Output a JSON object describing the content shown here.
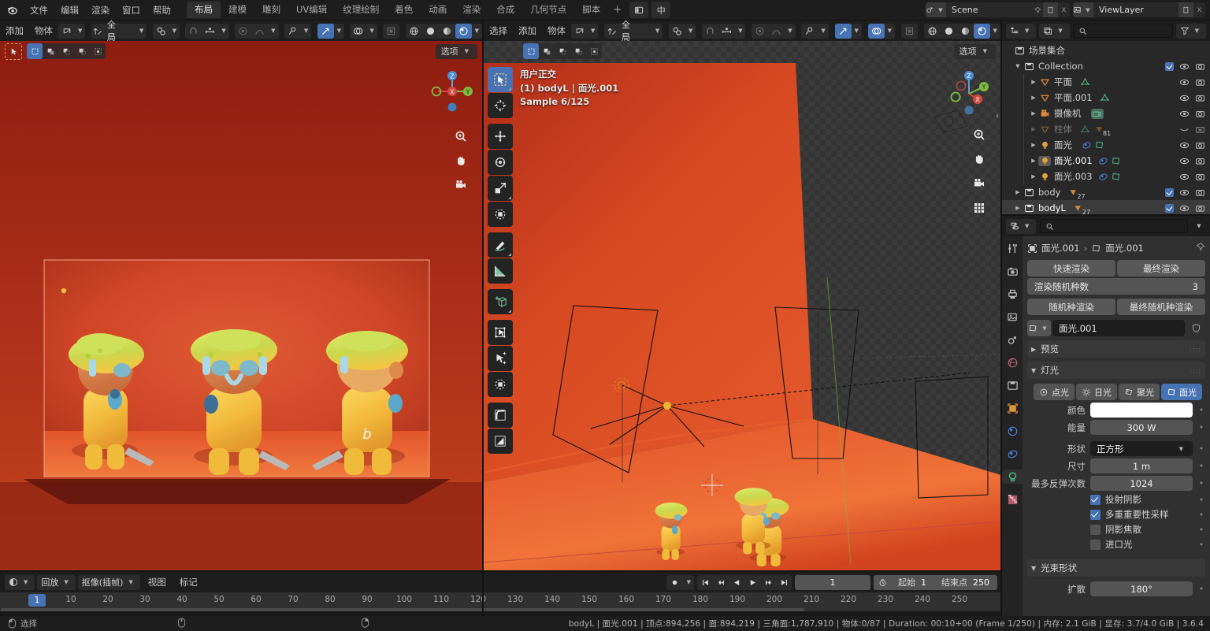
{
  "topbar": {
    "logo_icon": "blender-logo",
    "menus": [
      "文件",
      "编辑",
      "渲染",
      "窗口",
      "帮助"
    ],
    "workspaces": [
      "布局",
      "建模",
      "雕刻",
      "UV编辑",
      "纹理绘制",
      "着色",
      "动画",
      "渲染",
      "合成",
      "几何节点",
      "脚本"
    ],
    "workspace_active": "布局",
    "add_workspace": "+",
    "screen_icon": "screen-icon",
    "lang_label": "中",
    "scene": {
      "name": "Scene",
      "icon": "scene-icon",
      "pin_icon": "pin-icon",
      "new_icon": "duplicate-icon",
      "unlink": "x"
    },
    "viewlayer": {
      "name": "ViewLayer",
      "icon": "viewlayer-icon",
      "new_icon": "duplicate-icon",
      "unlink": "x"
    }
  },
  "header_left": {
    "menus": [
      "添加",
      "物体"
    ],
    "transform_orientation": "全局",
    "snap_icon": "magnet-icon",
    "proportional_icon": "proportional-icon",
    "shading_modes": [
      "wireframe-icon",
      "solid-icon",
      "material-preview-icon",
      "rendered-icon"
    ],
    "shading_active": "rendered-icon"
  },
  "header_right": {
    "menus": [
      "选择",
      "添加",
      "物体"
    ],
    "transform_orientation": "全局",
    "snap_icon": "magnet-icon",
    "proportional_icon": "proportional-icon",
    "shading_modes": [
      "wireframe-icon",
      "solid-icon",
      "material-preview-icon",
      "rendered-icon"
    ],
    "shading_active": "rendered-icon"
  },
  "viewport_left": {
    "options_label": "选项",
    "select_modes": [
      "tweak-icon",
      "box-select-icon",
      "circle-select-icon",
      "lasso-select-icon",
      "select-box-icon"
    ],
    "gizmo_axes": [
      "Z",
      "Y",
      "X"
    ]
  },
  "viewport_right": {
    "options_label": "选项",
    "overlay_view": "用户正交",
    "overlay_object": "(1) bodyL | 面光.001",
    "overlay_sample": "Sample 6/125",
    "gizmo_axes": [
      "Z",
      "Y",
      "X"
    ],
    "nav_buttons": [
      "zoom-icon",
      "pan-hand-icon",
      "camera-view-icon",
      "toggle-ortho-icon"
    ],
    "tools": [
      "tweak-select-icon",
      "cursor-icon",
      "move-icon",
      "rotate-icon",
      "scale-icon",
      "transform-icon",
      "annotate-icon",
      "measure-icon",
      "add-cube-icon",
      "shear-icon",
      "to-sphere-icon",
      "transform-fallback-icon",
      "bend-icon",
      "mirror-icon"
    ],
    "tool_active": "tweak-select-icon"
  },
  "outliner": {
    "display_mode_icon": "outliner-display-icon",
    "filter_icon": "filter-icon",
    "search_placeholder": "",
    "scene_collection": "场景集合",
    "items": [
      {
        "label": "Collection",
        "icon": "collection-icon",
        "indent": 1,
        "expanded": true,
        "checkbox": true,
        "eye": true,
        "camera": true,
        "disclosure": "down"
      },
      {
        "label": "平面",
        "icon": "mesh-icon",
        "indent": 2,
        "data_icons": [
          "mesh-data-icon"
        ],
        "eye": true,
        "camera": true,
        "disclosure": "right"
      },
      {
        "label": "平面.001",
        "icon": "mesh-icon",
        "indent": 2,
        "data_icons": [
          "mesh-data-icon"
        ],
        "eye": true,
        "camera": true,
        "disclosure": "right"
      },
      {
        "label": "摄像机",
        "icon": "camera-obj-icon",
        "indent": 2,
        "data_icons": [
          "camera-data-icon"
        ],
        "eye": true,
        "camera": true,
        "disclosure": "right"
      },
      {
        "label": "柱体",
        "icon": "mesh-icon",
        "indent": 2,
        "dim": true,
        "data_icons": [
          "mesh-data-icon",
          "material-icon"
        ],
        "badge": "81",
        "eye": false,
        "camera": false,
        "disclosure": "right"
      },
      {
        "label": "面光",
        "icon": "light-icon",
        "indent": 2,
        "data_icons": [
          "light-data-icon",
          "area-light-icon"
        ],
        "eye": true,
        "camera": true,
        "disclosure": "right"
      },
      {
        "label": "面光.001",
        "icon": "light-icon",
        "indent": 2,
        "selected": true,
        "data_icons": [
          "light-data-icon",
          "area-light-icon"
        ],
        "eye": true,
        "camera": true,
        "disclosure": "right"
      },
      {
        "label": "面光.003",
        "icon": "light-icon",
        "indent": 2,
        "data_icons": [
          "light-data-icon",
          "area-light-icon"
        ],
        "eye": true,
        "camera": true,
        "disclosure": "right"
      },
      {
        "label": "body",
        "icon": "collection-icon",
        "indent": 1,
        "data_icons": [
          "material-icon"
        ],
        "badge": "27",
        "checkbox": true,
        "eye": true,
        "camera": true,
        "disclosure": "right"
      },
      {
        "label": "bodyL",
        "icon": "collection-icon",
        "indent": 1,
        "selected": true,
        "data_icons": [
          "material-icon"
        ],
        "badge": "27",
        "checkbox": true,
        "eye": true,
        "camera": true,
        "disclosure": "right"
      }
    ]
  },
  "properties": {
    "editor_icon": "properties-editor-icon",
    "search_placeholder": "",
    "breadcrumb": {
      "object": "面光.001",
      "separator": "›",
      "data": "面光.001",
      "object_icon": "object-icon",
      "data_icon": "area-light-icon",
      "pin_icon": "pin-icon"
    },
    "tabs": [
      "tool-icon",
      "render-icon",
      "output-icon",
      "viewlayer-icon",
      "scene-icon",
      "world-icon",
      "collection-icon",
      "object-icon",
      "physics-icon",
      "constraints-icon",
      "data-light-icon",
      "texture-icon"
    ],
    "tab_active": "data-light-icon",
    "quick_render": "快速渲染",
    "final_render": "最终渲染",
    "seed_label": "渲染随机种数",
    "seed_value": "3",
    "seed_render": "随机种渲染",
    "seed_final_render": "最终随机种渲染",
    "datablock_name": "面光.001",
    "panels": {
      "preview": "预览",
      "light": "灯光",
      "beam_shape": "光束形状"
    },
    "light_types": [
      {
        "label": "点光",
        "icon": "point-light-icon",
        "active": false
      },
      {
        "label": "日光",
        "icon": "sun-light-icon",
        "active": false
      },
      {
        "label": "聚光",
        "icon": "spot-light-icon",
        "active": false
      },
      {
        "label": "面光",
        "icon": "area-light-icon",
        "active": true
      }
    ],
    "fields": [
      {
        "label": "颜色",
        "value": "",
        "type": "color",
        "color": "#ffffff"
      },
      {
        "label": "能量",
        "value": "300 W",
        "type": "number"
      },
      {
        "label": "形状",
        "value": "正方形",
        "type": "dropdown"
      },
      {
        "label": "尺寸",
        "value": "1 m",
        "type": "number"
      },
      {
        "label": "最多反弹次数",
        "value": "1024",
        "type": "number"
      }
    ],
    "checkboxes": [
      {
        "label": "投射阴影",
        "checked": true
      },
      {
        "label": "多重重要性采样",
        "checked": true
      },
      {
        "label": "阴影焦散",
        "checked": false
      },
      {
        "label": "进口光",
        "checked": false
      }
    ],
    "beam_fields": [
      {
        "label": "扩散",
        "value": "180°"
      }
    ]
  },
  "timeline": {
    "editor_icon": "timeline-editor-icon",
    "menus": [
      "回放",
      "抠像(插帧)",
      "视图",
      "标记"
    ],
    "record_icon": "record-icon",
    "playback_buttons": [
      "jump-start-icon",
      "prev-keyframe-icon",
      "play-reverse-icon",
      "play-icon",
      "next-keyframe-icon",
      "jump-end-icon"
    ],
    "current_frame": "1",
    "timer_icon": "timer-icon",
    "start_label": "起始",
    "start_value": "1",
    "end_label": "结束点",
    "end_value": "250",
    "ticks": [
      "10",
      "20",
      "30",
      "40",
      "50",
      "60",
      "70",
      "80",
      "90",
      "100",
      "110",
      "120",
      "130",
      "140",
      "150",
      "160",
      "170",
      "180",
      "190",
      "200",
      "210",
      "220",
      "230",
      "240",
      "250"
    ],
    "playhead_frame": "1"
  },
  "statusbar": {
    "mouse_select_icon": "mouse-left-icon",
    "mouse_select_label": "选择",
    "mouse_middle_icon": "mouse-middle-icon",
    "mouse_right_icon": "mouse-right-icon",
    "info": "bodyL | 面光.001 | 顶点:894,256 | 面:894,219 | 三角面:1,787,910 | 物体:0/87 | Duration: 00:10+00 (Frame 1/250) | 内存: 2.1 GiB | 显存: 3.7/4.0 GiB | 3.6.4"
  },
  "colors": {
    "accent_blue": "#4772b3",
    "header_bg": "#1d1d1d",
    "panel_bg": "#303030",
    "outliner_bg": "#282828",
    "render_red": "#9c2616",
    "scene_orange": "#d8401f"
  }
}
